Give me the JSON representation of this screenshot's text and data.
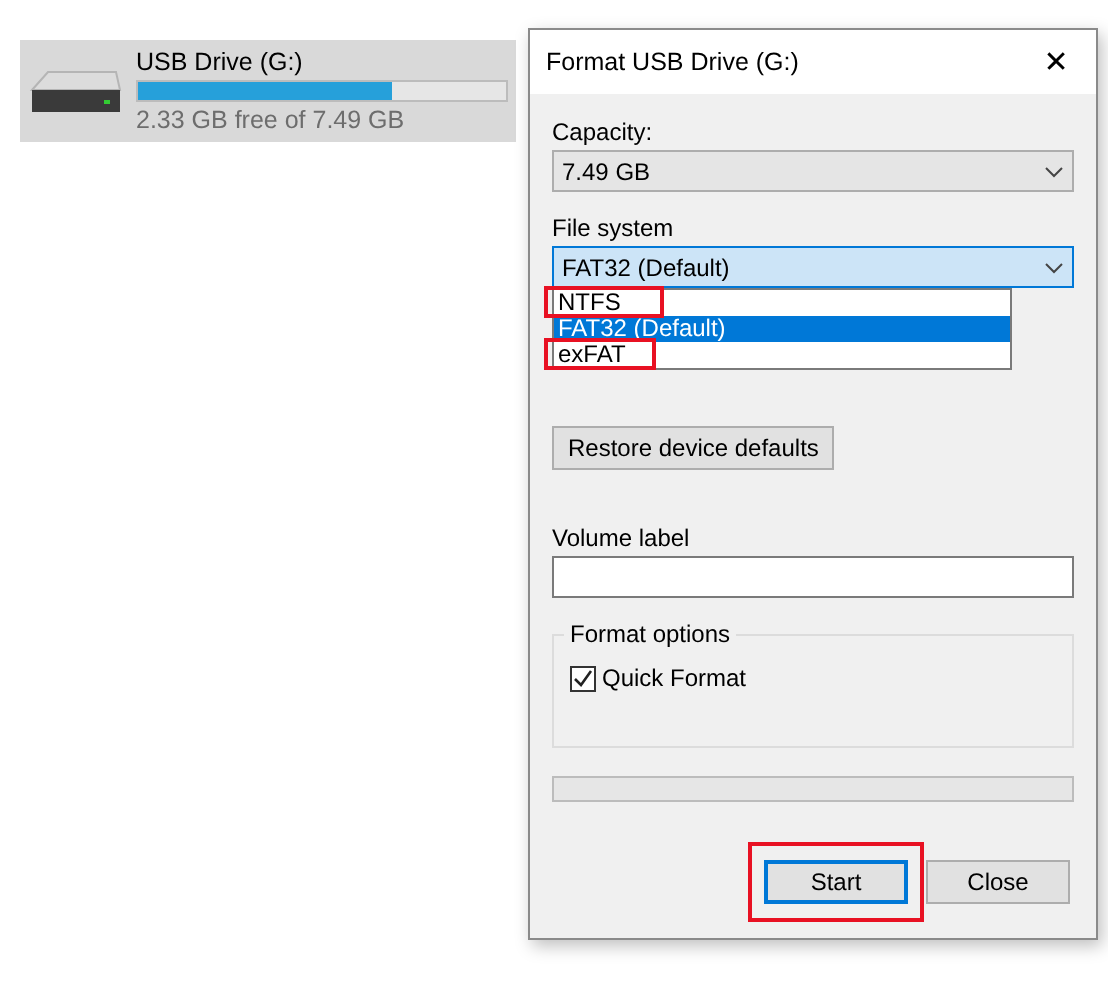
{
  "drive": {
    "name": "USB Drive (G:)",
    "level": 0.69,
    "free_text": "2.33 GB free of 7.49 GB"
  },
  "dialog": {
    "title": "Format USB Drive (G:)",
    "close_glyph": "✕",
    "capacity": {
      "label": "Capacity:",
      "value": "7.49 GB"
    },
    "file_system": {
      "label": "File system",
      "value": "FAT32 (Default)",
      "expanded": true,
      "options": [
        {
          "label": "NTFS",
          "selected": false,
          "highlighted": true
        },
        {
          "label": "FAT32 (Default)",
          "selected": true,
          "highlighted": false
        },
        {
          "label": "exFAT",
          "selected": false,
          "highlighted": true
        }
      ]
    },
    "restore_button": "Restore device defaults",
    "volume_label": {
      "label": "Volume label"
    },
    "format_options": {
      "title": "Format options",
      "quick_format": {
        "label": "Quick Format",
        "checked": true
      }
    },
    "buttons": [
      {
        "label": "Start",
        "default": true,
        "highlighted": true
      },
      {
        "label": "Close",
        "default": false,
        "highlighted": false
      }
    ]
  }
}
